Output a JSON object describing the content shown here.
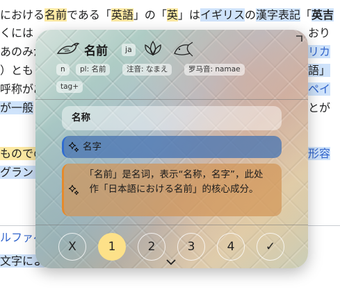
{
  "article": {
    "line1": {
      "a": "における",
      "b": "名前",
      "c": "である「",
      "d": "英語",
      "e": "」の「",
      "f": "英",
      "g": "」は",
      "h": "イギリス",
      "i": "の",
      "j": "漢字表記",
      "k": "「",
      "l": "英吉"
    },
    "line2": {
      "a": "くには",
      "b": "おり"
    },
    "line3": {
      "a": "あのみが",
      "b": "リカ"
    },
    "line4": {
      "a": "）とも",
      "b": "語」"
    },
    "line5": {
      "a": "呼称があ",
      "b": "ペイ"
    },
    "line6": {
      "a": "が一般",
      "b": "とが"
    },
    "line8": {
      "a": "ものでの",
      "b": "形容"
    },
    "line9": {
      "a": "グラント"
    },
    "line11": {
      "a": "ルファベ"
    },
    "line12": {
      "a": "文字によ"
    }
  },
  "popup": {
    "headword": "名前",
    "lang_badge": "ja",
    "chips": [
      "n",
      "pl: 名前",
      "注音: なまえ",
      "罗马音: namae",
      "tag+"
    ],
    "sense_title": "名称",
    "sense_gloss": "名字",
    "sense_explain": "「名前」是名词，表示“名称，名字”，此处作「日本語における名前」的核心成分。",
    "grades": [
      "X",
      "1",
      "2",
      "3",
      "4",
      "✓"
    ],
    "active_grade": "1",
    "colors": {
      "active_grade": "#fde189",
      "blue_bar": "#2f6bd1",
      "orange_bar": "#e58a2c"
    }
  }
}
